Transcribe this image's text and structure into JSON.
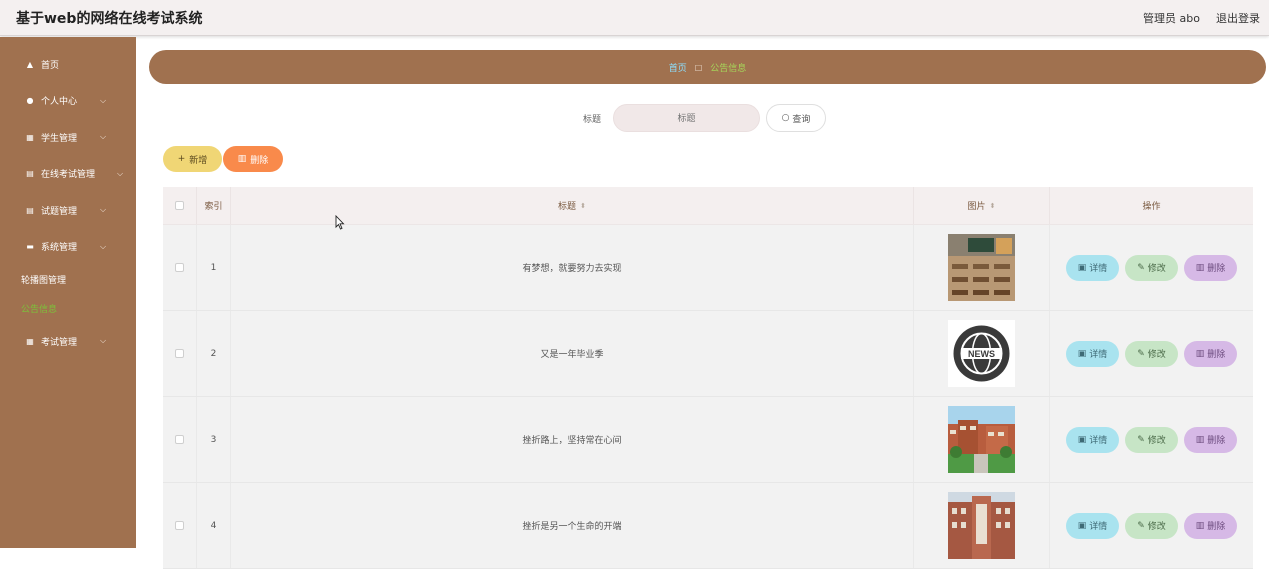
{
  "header": {
    "title": "基于web的网络在线考试系统",
    "user": "管理员 abo",
    "logout": "退出登录"
  },
  "sidebar": {
    "items": [
      {
        "label": "首页",
        "icon": "home-icon"
      },
      {
        "label": "个人中心",
        "icon": "user-icon"
      },
      {
        "label": "学生管理",
        "icon": "grid-icon"
      },
      {
        "label": "在线考试管理",
        "icon": "clipboard-icon"
      },
      {
        "label": "试题管理",
        "icon": "clipboard-icon"
      },
      {
        "label": "系统管理",
        "icon": "server-icon"
      },
      {
        "label": "考试管理",
        "icon": "grid-icon"
      }
    ],
    "subitems": [
      {
        "label": "轮播图管理",
        "active": false
      },
      {
        "label": "公告信息",
        "active": true
      }
    ]
  },
  "breadcrumb": {
    "home": "首页",
    "current": "公告信息"
  },
  "search": {
    "label": "标题",
    "placeholder": "标题",
    "button": "查询"
  },
  "toolbar": {
    "add": "新增",
    "delete": "删除"
  },
  "table": {
    "headers": {
      "index": "索引",
      "title": "标题",
      "image": "图片",
      "actions": "操作"
    },
    "rows": [
      {
        "index": "1",
        "title": "有梦想，就要努力去实现",
        "image": "classroom"
      },
      {
        "index": "2",
        "title": "又是一年毕业季",
        "image": "news"
      },
      {
        "index": "3",
        "title": "挫折路上，坚持常在心间",
        "image": "campus"
      },
      {
        "index": "4",
        "title": "挫折是另一个生命的开端",
        "image": "building"
      }
    ],
    "row_actions": {
      "detail": "详情",
      "edit": "修改",
      "delete": "删除"
    }
  },
  "colors": {
    "brand": "#a0714f",
    "add": "#f0d675",
    "delete": "#f98a4b",
    "active": "#7cc23a"
  }
}
